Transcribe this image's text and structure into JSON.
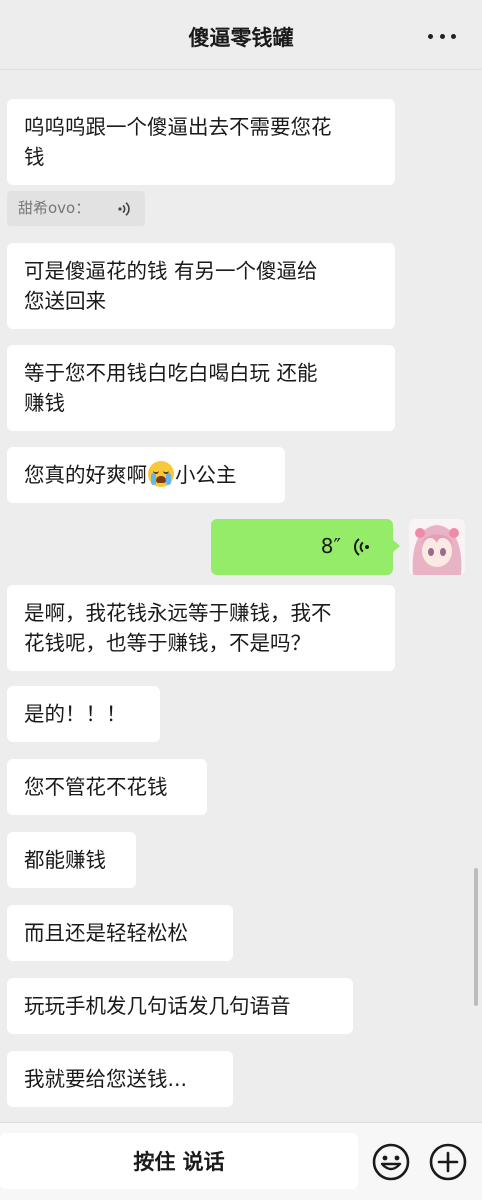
{
  "header": {
    "title": "傻逼零钱罐",
    "more_icon": "more-icon"
  },
  "messages": {
    "m1": "呜呜呜跟一个傻逼出去不需要您花\n钱",
    "sender_name": "甜希ovo：",
    "m2": "可是傻逼花的钱 有另一个傻逼给\n您送回来",
    "m3": "等于您不用钱白吃白喝白玩 还能\n赚钱",
    "m4_before": "您真的好爽啊",
    "m4_after": "小公主",
    "voice_duration": "8″",
    "m5": "是啊，我花钱永远等于赚钱，我不\n花钱呢，也等于赚钱，不是吗？",
    "m6": "是的！！！",
    "m7": "您不管花不花钱",
    "m8": "都能赚钱",
    "m9": "而且还是轻轻松松",
    "m10": "玩玩手机发几句话发几句语音",
    "m11": "我就要给您送钱..."
  },
  "bottom": {
    "hold_to_talk": "按住 说话"
  },
  "colors": {
    "background": "#ededed",
    "bubble_in": "#ffffff",
    "bubble_out": "#95ec69"
  }
}
